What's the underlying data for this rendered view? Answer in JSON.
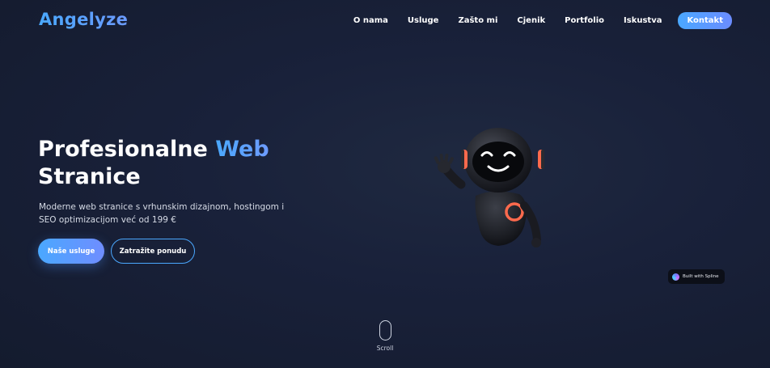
{
  "brand": {
    "logo": "Angelyze"
  },
  "nav": {
    "items": [
      {
        "label": "O nama"
      },
      {
        "label": "Usluge"
      },
      {
        "label": "Zašto mi"
      },
      {
        "label": "Cjenik"
      },
      {
        "label": "Portfolio"
      },
      {
        "label": "Iskustva"
      }
    ],
    "cta_label": "Kontakt"
  },
  "hero": {
    "title_part1": "Profesionalne ",
    "title_accent": "Web",
    "title_part2": "Stranice",
    "subtitle": "Moderne web stranice s vrhunskim dizajnom, hostingom i SEO optimizacijom već od 199 €",
    "primary_button": "Naše usluge",
    "secondary_button": "Zatražite ponudu"
  },
  "spline_badge": {
    "label": "Built with Spline"
  },
  "scroll": {
    "label": "Scroll"
  },
  "colors": {
    "accent": "#4aa8ff",
    "background": "#19213a",
    "robot_glow": "#ff6a4d"
  },
  "icons": {
    "robot": "robot-mascot-illustration",
    "spline": "spline-logo-icon",
    "scroll": "mouse-scroll-icon"
  }
}
